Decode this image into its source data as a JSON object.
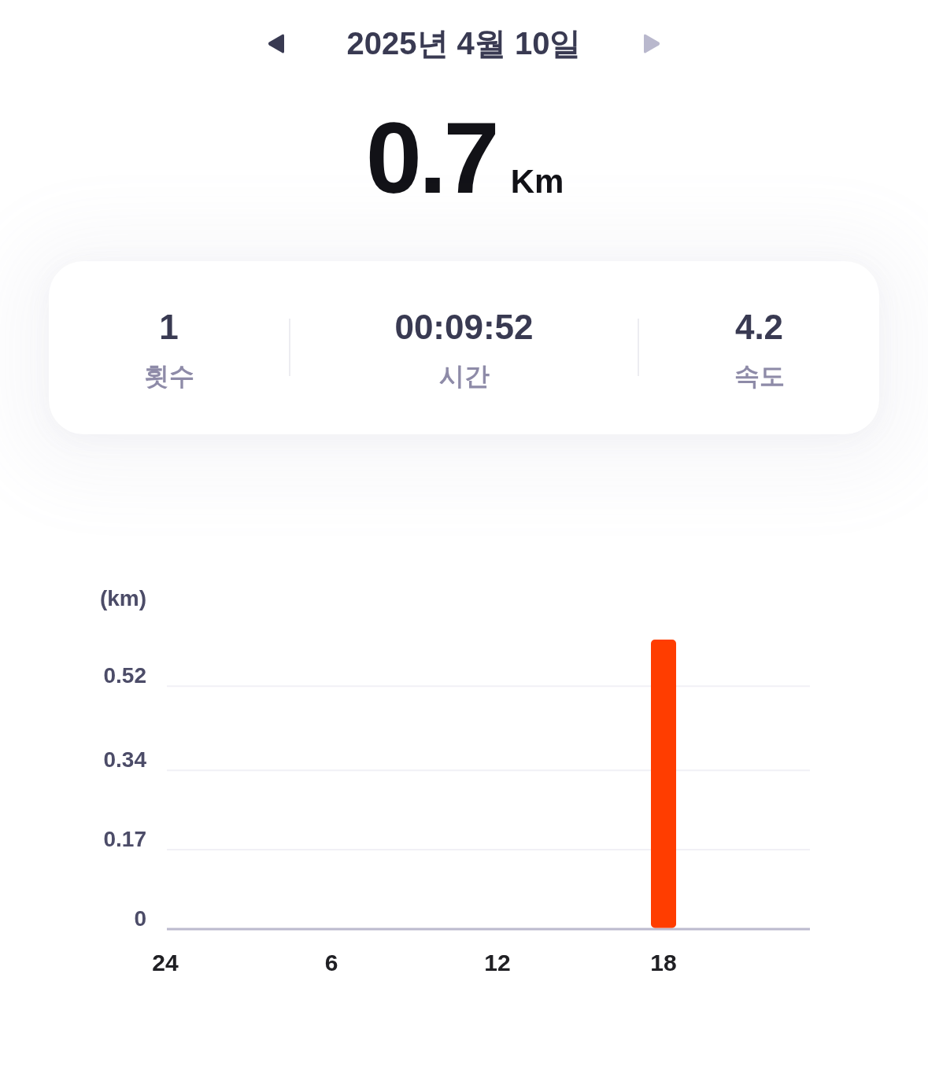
{
  "date_nav": {
    "previous": {
      "disabled": false
    },
    "date": "2025년 4월 10일",
    "next": {
      "disabled": true
    }
  },
  "distance": {
    "value": "0.7",
    "unit": "Km"
  },
  "stats": [
    {
      "value": "1",
      "label": "횟수"
    },
    {
      "value": "00:09:52",
      "label": "시간"
    },
    {
      "value": "4.2",
      "label": "속도"
    }
  ],
  "chart": {
    "chart_data": {
      "type": "bar",
      "ylabel": "(km)",
      "categories": [
        "24",
        "6",
        "12",
        "18"
      ],
      "values": [
        null,
        null,
        null,
        0.62
      ],
      "ylim": [
        0,
        0.62
      ],
      "yticks": [
        0,
        0.17,
        0.34,
        0.52
      ],
      "grid": true
    }
  }
}
